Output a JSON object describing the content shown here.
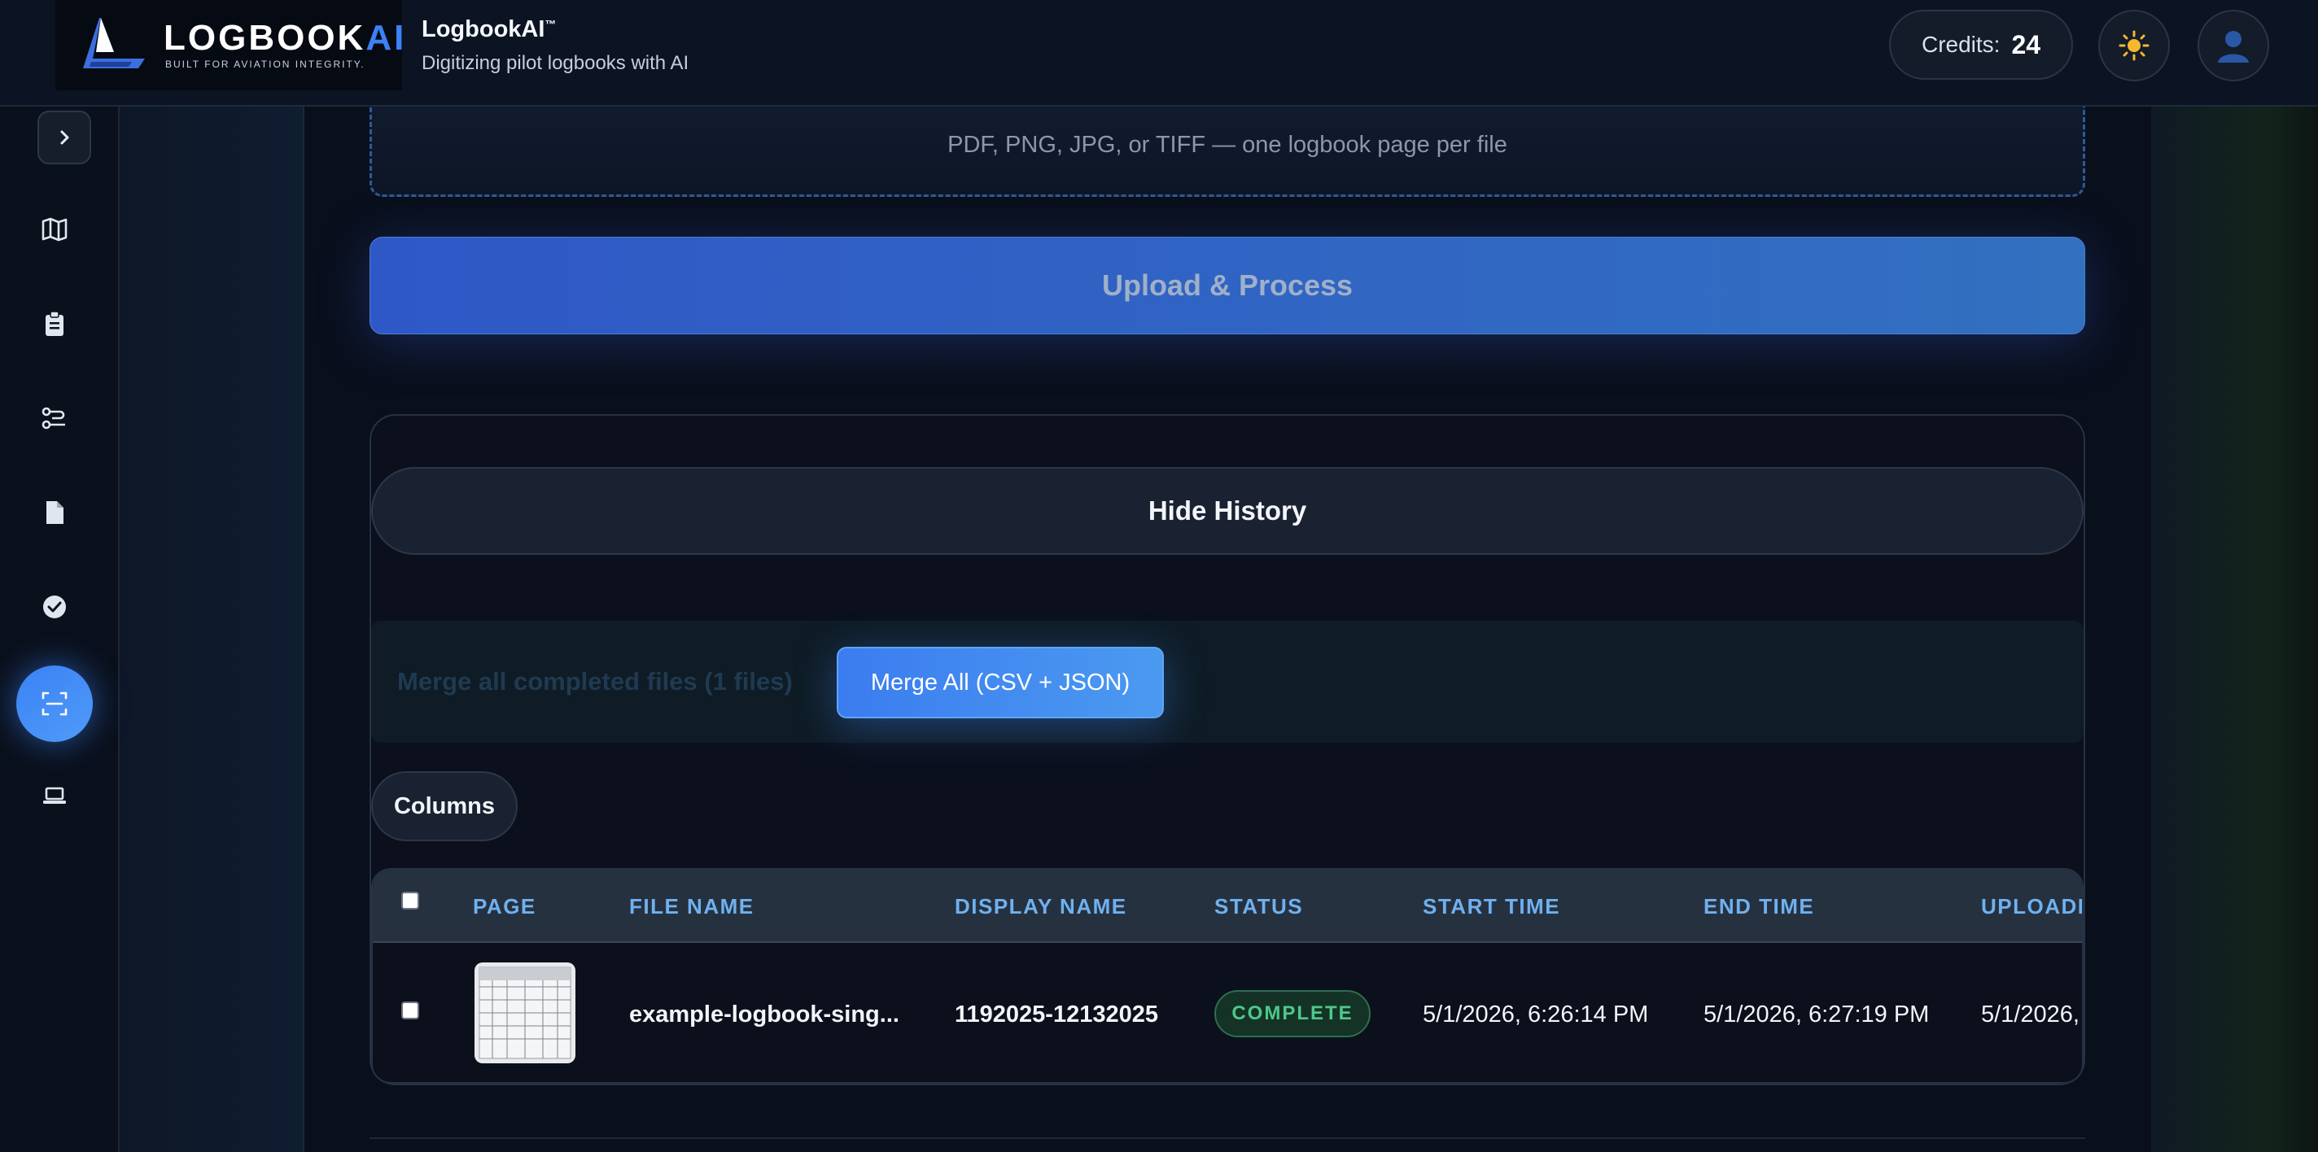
{
  "header": {
    "logo_main": "LOGBOOK",
    "logo_accent": "AI",
    "logo_tagline": "BUILT FOR AVIATION INTEGRITY.",
    "app_name": "LogbookAI",
    "app_name_mark": "™",
    "app_subtitle": "Digitizing pilot logbooks with AI",
    "credits_label": "Credits:",
    "credits_value": "24",
    "theme_icon": "sun-icon",
    "profile_icon": "user-icon"
  },
  "sidebar": {
    "expand_icon": "chevron-right-icon",
    "items": [
      {
        "icon": "map-icon",
        "active": false
      },
      {
        "icon": "clipboard-icon",
        "active": false
      },
      {
        "icon": "route-icon",
        "active": false
      },
      {
        "icon": "document-icon",
        "active": false
      },
      {
        "icon": "check-circle-icon",
        "active": false
      },
      {
        "icon": "scan-icon",
        "active": true
      },
      {
        "icon": "laptop-icon",
        "active": false
      }
    ]
  },
  "upload": {
    "formats_text": "PDF, PNG, JPG, or TIFF — one logbook page per file",
    "process_button": "Upload & Process"
  },
  "history": {
    "toggle_button": "Hide History",
    "merge_text": "Merge all completed files (1 files)",
    "merge_button": "Merge All (CSV + JSON)",
    "columns_button": "Columns",
    "table": {
      "headers": [
        "PAGE",
        "FILE NAME",
        "DISPLAY NAME",
        "STATUS",
        "START TIME",
        "END TIME",
        "UPLOADE"
      ],
      "rows": [
        {
          "file_name": "example-logbook-sing...",
          "display_name": "1192025-12132025",
          "status": "COMPLETE",
          "start_time": "5/1/2026, 6:26:14 PM",
          "end_time": "5/1/2026, 6:27:19 PM",
          "uploaded": "5/1/2026,"
        }
      ]
    }
  },
  "colors": {
    "accent": "#3b82f6",
    "background": "#0b1220",
    "status_complete": "#4ec88b",
    "header_text": "#6fb1ef"
  }
}
